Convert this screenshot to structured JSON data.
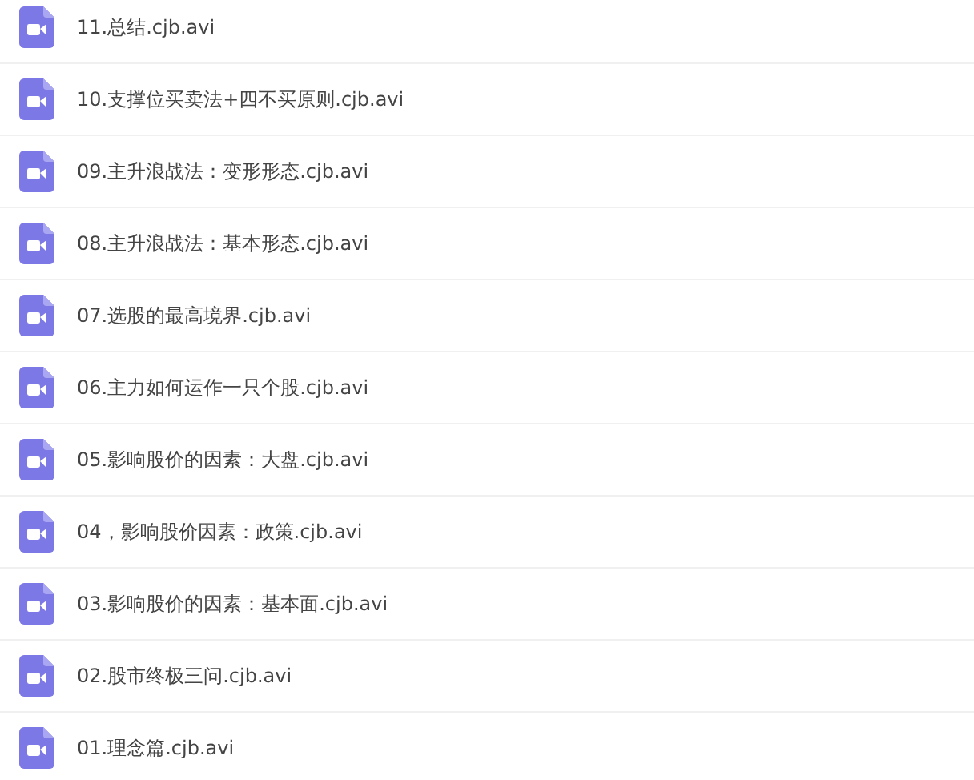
{
  "files": [
    {
      "name": "11.总结.cjb.avi"
    },
    {
      "name": "10.支撑位买卖法+四不买原则.cjb.avi"
    },
    {
      "name": "09.主升浪战法：变形形态.cjb.avi"
    },
    {
      "name": "08.主升浪战法：基本形态.cjb.avi"
    },
    {
      "name": "07.选股的最高境界.cjb.avi"
    },
    {
      "name": "06.主力如何运作一只个股.cjb.avi"
    },
    {
      "name": "05.影响股价的因素：大盘.cjb.avi"
    },
    {
      "name": "04，影响股价因素：政策.cjb.avi"
    },
    {
      "name": "03.影响股价的因素：基本面.cjb.avi"
    },
    {
      "name": "02.股市终极三问.cjb.avi"
    },
    {
      "name": "01.理念篇.cjb.avi"
    }
  ]
}
